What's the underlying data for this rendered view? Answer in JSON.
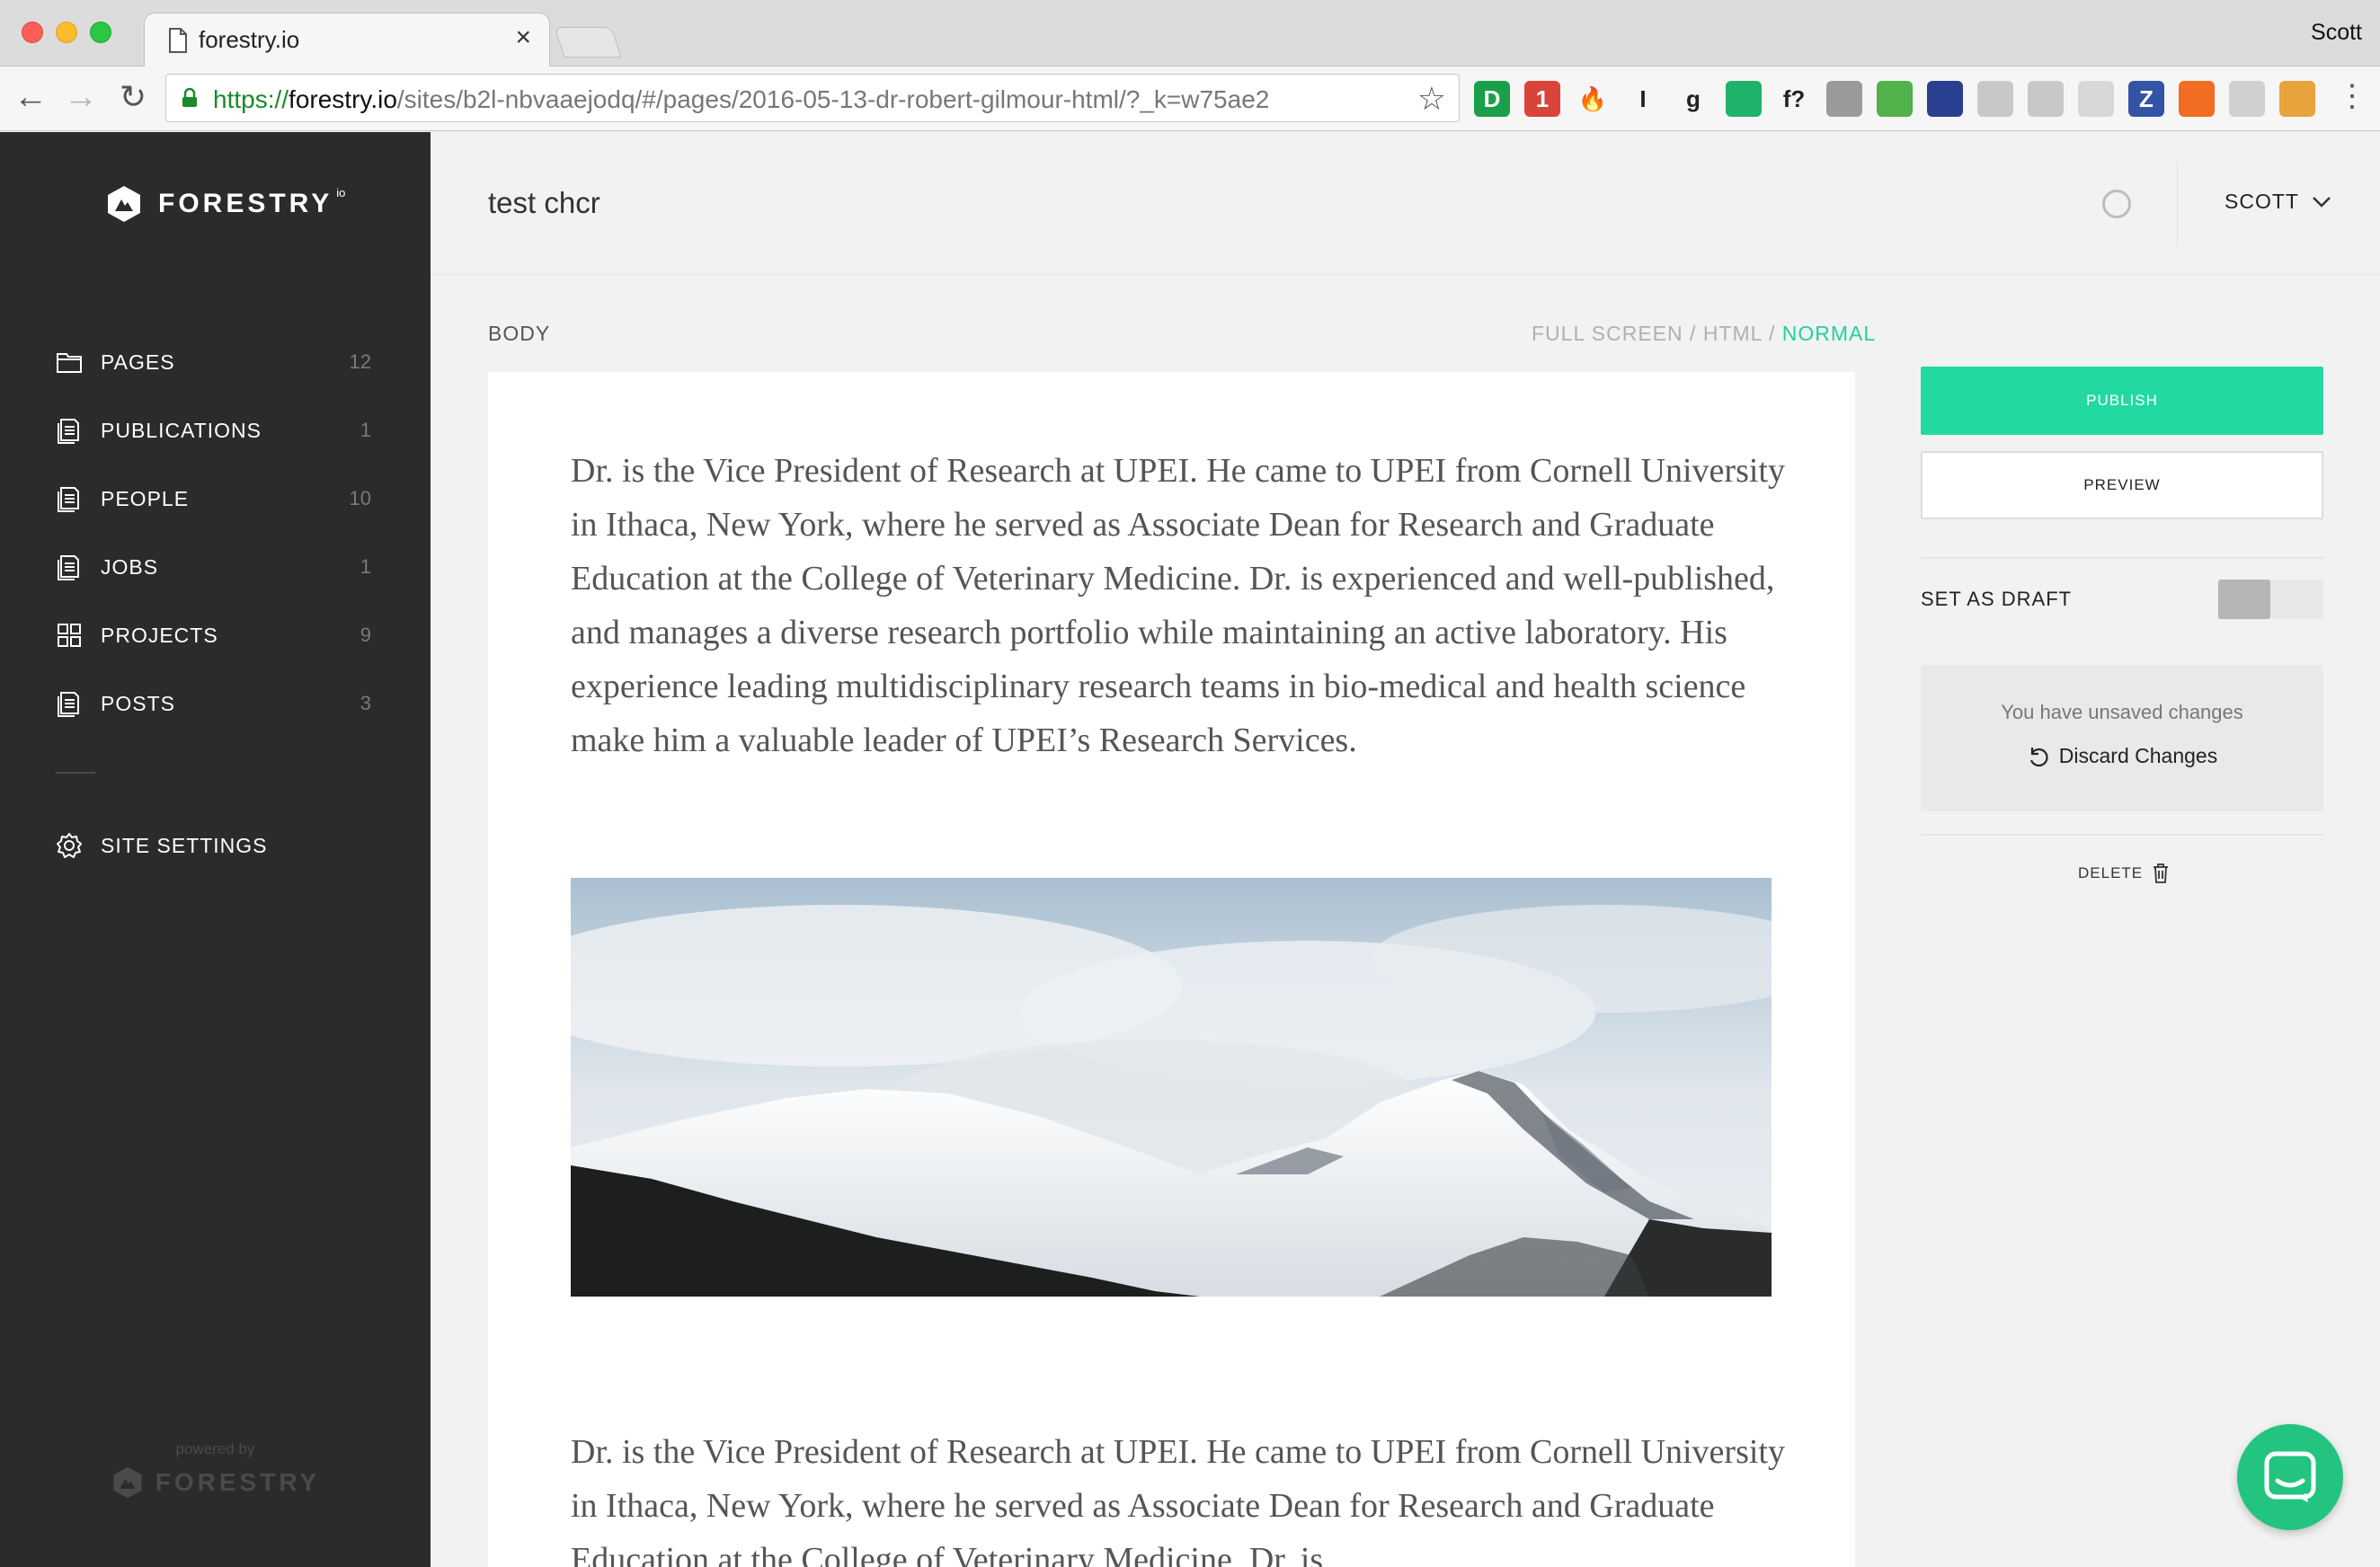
{
  "browser": {
    "tab_title": "forestry.io",
    "close_glyph": "×",
    "os_user": "Scott",
    "url": {
      "scheme": "https://",
      "host": "forestry.io",
      "path": "/sites/b2l-nbvaaejodq/#/pages/2016-05-13-dr-robert-gilmour-html/?_k=w75ae2"
    },
    "extensions": [
      {
        "name": "dashlane-icon",
        "glyph": "D",
        "color": "#1aa04a"
      },
      {
        "name": "calendar-icon",
        "glyph": "1",
        "color": "#d9443a"
      },
      {
        "name": "fire-icon",
        "glyph": "🔥",
        "color": "#f6f6f6"
      },
      {
        "name": "instapaper-icon",
        "glyph": "I",
        "color": "#f6f6f6"
      },
      {
        "name": "grammar-icon",
        "glyph": "g",
        "color": "#f6f6f6"
      },
      {
        "name": "green-dot-icon",
        "glyph": "",
        "color": "#1fb26a"
      },
      {
        "name": "whatfont-icon",
        "glyph": "f?",
        "color": "#f6f6f6"
      },
      {
        "name": "camera-icon",
        "glyph": "",
        "color": "#9a9a9a"
      },
      {
        "name": "print-icon",
        "glyph": "",
        "color": "#51b14a"
      },
      {
        "name": "color-picker-icon",
        "glyph": "",
        "color": "#2a3f8f"
      },
      {
        "name": "dropbox-icon",
        "glyph": "",
        "color": "#c8c8c8"
      },
      {
        "name": "window-icon",
        "glyph": "",
        "color": "#c8c8c8"
      },
      {
        "name": "card-icon",
        "glyph": "",
        "color": "#d8d8d8"
      },
      {
        "name": "zotero-icon",
        "glyph": "Z",
        "color": "#3354a5"
      },
      {
        "name": "fox-icon",
        "glyph": "",
        "color": "#f26c22"
      },
      {
        "name": "hex-icon",
        "glyph": "",
        "color": "#d0d0d0"
      },
      {
        "name": "chrome-eye-icon",
        "glyph": "",
        "color": "#e8a33b"
      }
    ]
  },
  "sidebar": {
    "logo_text": "FORESTRY",
    "logo_sup": "io",
    "items": [
      {
        "name": "pages",
        "label": "PAGES",
        "count": "12",
        "icon": "folder-icon"
      },
      {
        "name": "publications",
        "label": "PUBLICATIONS",
        "count": "1",
        "icon": "document-icon"
      },
      {
        "name": "people",
        "label": "PEOPLE",
        "count": "10",
        "icon": "document-icon"
      },
      {
        "name": "jobs",
        "label": "JOBS",
        "count": "1",
        "icon": "document-icon"
      },
      {
        "name": "projects",
        "label": "PROJECTS",
        "count": "9",
        "icon": "grid-icon"
      },
      {
        "name": "posts",
        "label": "POSTS",
        "count": "3",
        "icon": "document-icon"
      }
    ],
    "settings_label": "SITE SETTINGS",
    "powered_by": "powered by",
    "powered_logo": "FORESTRY"
  },
  "header": {
    "title": "test chcr",
    "user": "SCOTT"
  },
  "editor": {
    "field_label": "BODY",
    "modes": {
      "full_screen": "FULL SCREEN",
      "separator": " / ",
      "html": "HTML",
      "separator2": " / ",
      "normal": "NORMAL"
    },
    "paragraph_1": "Dr.  is the Vice President of Research at UPEI. He came to UPEI from Cornell University in Ithaca, New York, where he served as Associate Dean for Research and Graduate Education at the College of Veterinary Medicine. Dr. is experienced and well-published, and manages a diverse research portfolio while maintaining an active laboratory. His experience leading multidisciplinary research teams in bio-medical and health science make him a valuable leader of UPEI’s Research Services.",
    "paragraph_2": "Dr. is the Vice President of Research at UPEI. He came to UPEI from Cornell University in Ithaca, New York, where he served as Associate Dean for Research and Graduate Education at the College of Veterinary Medicine. Dr. is"
  },
  "panel": {
    "publish_label": "PUBLISH",
    "preview_label": "PREVIEW",
    "draft_label": "SET AS DRAFT",
    "unsaved_message": "You have unsaved changes",
    "discard_label": "Discard Changes",
    "delete_label": "DELETE"
  },
  "colors": {
    "accent": "#22d9a1",
    "sidebar_bg": "#2b2b2b",
    "chat": "#22c47f"
  }
}
